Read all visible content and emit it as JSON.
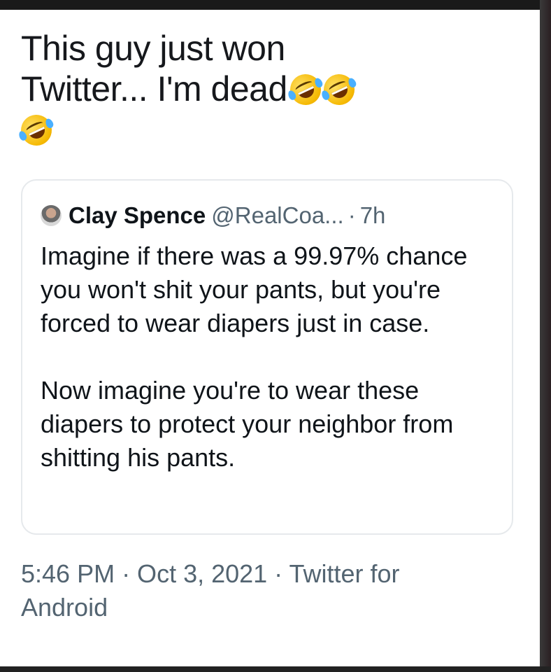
{
  "tweet": {
    "line1": "This guy just won",
    "line2": "Twitter... I'm dead",
    "emoji_icon": "rolling-on-floor-laughing"
  },
  "quoted_tweet": {
    "author_name": "Clay Spence",
    "author_handle": "@RealCoa...",
    "separator": "·",
    "age": "7h",
    "paragraph1": "Imagine if there was a 99.97% chance you won't shit your pants, but you're forced to wear diapers just in case.",
    "paragraph2": "Now imagine you're to wear these diapers to protect your neighbor from shitting his pants."
  },
  "meta": {
    "timestamp": "5:46 PM · Oct 3, 2021 · Twitter for Android"
  }
}
